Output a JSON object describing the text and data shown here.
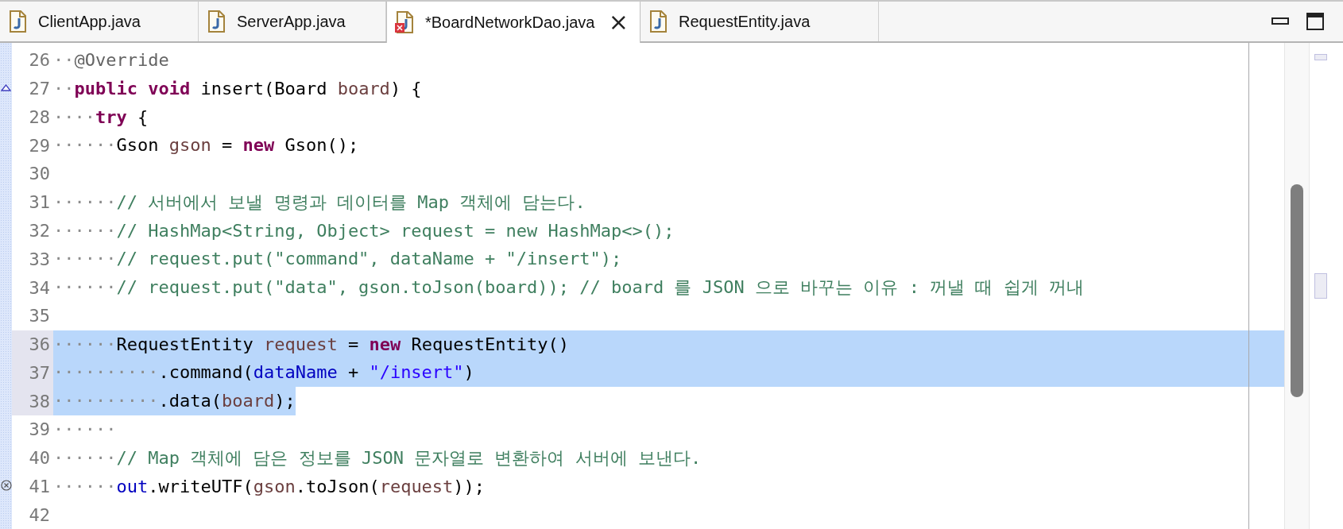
{
  "tabs": [
    {
      "label": "ClientApp.java",
      "selected": false,
      "error": false,
      "closable": false
    },
    {
      "label": "ServerApp.java",
      "selected": false,
      "error": false,
      "closable": false
    },
    {
      "label": "*BoardNetworkDao.java",
      "selected": true,
      "error": true,
      "closable": true
    },
    {
      "label": "RequestEntity.java",
      "selected": false,
      "error": false,
      "closable": false
    }
  ],
  "close_glyph": "×",
  "editor": {
    "lines": [
      {
        "number": "26",
        "selected": false,
        "tokens": [
          {
            "kind": "ws",
            "text": "··"
          },
          {
            "kind": "annotation",
            "text": "@Override"
          }
        ]
      },
      {
        "number": "27",
        "selected": false,
        "marker": {
          "kind": "override"
        },
        "tokens": [
          {
            "kind": "ws",
            "text": "··"
          },
          {
            "kind": "keyword",
            "text": "public void"
          },
          {
            "kind": "plain",
            "text": " insert(Board "
          },
          {
            "kind": "local",
            "text": "board"
          },
          {
            "kind": "plain",
            "text": ") {"
          }
        ]
      },
      {
        "number": "28",
        "selected": false,
        "tokens": [
          {
            "kind": "ws",
            "text": "····"
          },
          {
            "kind": "keyword",
            "text": "try"
          },
          {
            "kind": "plain",
            "text": " {"
          }
        ]
      },
      {
        "number": "29",
        "selected": false,
        "tokens": [
          {
            "kind": "ws",
            "text": "······"
          },
          {
            "kind": "plain",
            "text": "Gson "
          },
          {
            "kind": "local",
            "text": "gson"
          },
          {
            "kind": "plain",
            "text": " = "
          },
          {
            "kind": "keyword",
            "text": "new"
          },
          {
            "kind": "plain",
            "text": " Gson();"
          }
        ]
      },
      {
        "number": "30",
        "selected": false
      },
      {
        "number": "31",
        "selected": false,
        "tokens": [
          {
            "kind": "ws",
            "text": "······"
          },
          {
            "kind": "comment",
            "text": "// 서버에서 보낼 명령과 데이터를 Map 객체에 담는다."
          }
        ]
      },
      {
        "number": "32",
        "selected": false,
        "tokens": [
          {
            "kind": "ws",
            "text": "······"
          },
          {
            "kind": "comment",
            "text": "// HashMap<String, Object> request = new HashMap<>();"
          }
        ]
      },
      {
        "number": "33",
        "selected": false,
        "tokens": [
          {
            "kind": "ws",
            "text": "······"
          },
          {
            "kind": "comment",
            "text": "// request.put(\"command\", dataName + \"/insert\");"
          }
        ]
      },
      {
        "number": "34",
        "selected": false,
        "tokens": [
          {
            "kind": "ws",
            "text": "······"
          },
          {
            "kind": "comment",
            "text": "// request.put(\"data\", gson.toJson(board)); // board 를 JSON 으로 바꾸는 이유 : 꺼낼 때 쉽게 꺼내"
          }
        ]
      },
      {
        "number": "35",
        "selected": false
      },
      {
        "number": "36",
        "selected": true,
        "tokens": [
          {
            "kind": "ws",
            "text": "······"
          },
          {
            "kind": "plain",
            "text": "RequestEntity "
          },
          {
            "kind": "local",
            "text": "request"
          },
          {
            "kind": "plain",
            "text": " = "
          },
          {
            "kind": "keyword",
            "text": "new"
          },
          {
            "kind": "plain",
            "text": " RequestEntity()"
          }
        ]
      },
      {
        "number": "37",
        "selected": true,
        "tokens": [
          {
            "kind": "ws",
            "text": "··········"
          },
          {
            "kind": "plain",
            "text": ".command("
          },
          {
            "kind": "field",
            "text": "dataName"
          },
          {
            "kind": "plain",
            "text": " + "
          },
          {
            "kind": "string",
            "text": "\"/insert\""
          },
          {
            "kind": "plain",
            "text": ")"
          }
        ]
      },
      {
        "number": "38",
        "selected": true,
        "tokens": [
          {
            "kind": "ws",
            "text": "··········"
          },
          {
            "kind": "plain",
            "text": ".data("
          },
          {
            "kind": "local",
            "text": "board"
          },
          {
            "kind": "plain",
            "text": ");"
          }
        ]
      },
      {
        "number": "39",
        "selected": false,
        "tokens": [
          {
            "kind": "ws",
            "text": "······"
          }
        ]
      },
      {
        "number": "40",
        "selected": false,
        "tokens": [
          {
            "kind": "ws",
            "text": "······"
          },
          {
            "kind": "comment",
            "text": "// Map 객체에 담은 정보를 JSON 문자열로 변환하여 서버에 보낸다."
          }
        ]
      },
      {
        "number": "41",
        "selected": false,
        "marker": {
          "kind": "error"
        },
        "tokens": [
          {
            "kind": "ws",
            "text": "······"
          },
          {
            "kind": "field",
            "text": "out"
          },
          {
            "kind": "plain",
            "text": ".writeUTF("
          },
          {
            "kind": "local",
            "text": "gson"
          },
          {
            "kind": "plain",
            "text": ".toJson("
          },
          {
            "kind": "local",
            "text": "request"
          },
          {
            "kind": "plain",
            "text": "));"
          }
        ]
      },
      {
        "number": "42",
        "selected": false
      }
    ]
  }
}
